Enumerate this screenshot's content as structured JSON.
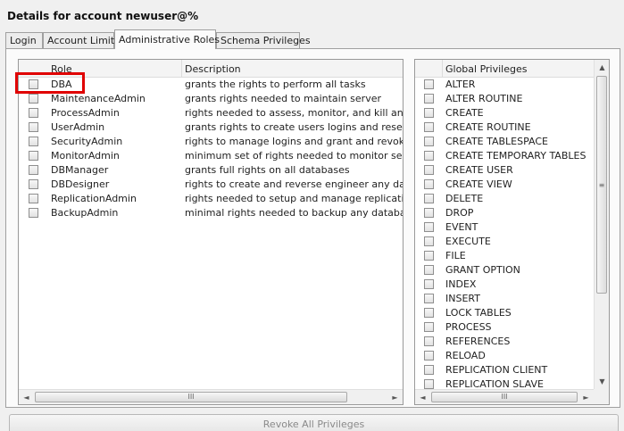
{
  "header": {
    "title": "Details for account newuser@%"
  },
  "tabs": [
    {
      "label": "Login",
      "active": false
    },
    {
      "label": "Account Limits",
      "active": false
    },
    {
      "label": "Administrative Roles",
      "active": true
    },
    {
      "label": "Schema Privileges",
      "active": false
    }
  ],
  "roles": {
    "col_role": "Role",
    "col_description": "Description",
    "items": [
      {
        "role": "DBA",
        "description": "grants the rights to perform all tasks",
        "checked": false
      },
      {
        "role": "MaintenanceAdmin",
        "description": "grants rights needed to maintain server",
        "checked": false
      },
      {
        "role": "ProcessAdmin",
        "description": "rights needed to assess, monitor, and kill any use",
        "checked": false
      },
      {
        "role": "UserAdmin",
        "description": "grants rights to create users logins and reset pas",
        "checked": false
      },
      {
        "role": "SecurityAdmin",
        "description": "rights to manage logins and grant and revoke se",
        "checked": false
      },
      {
        "role": "MonitorAdmin",
        "description": "minimum set of rights needed to monitor server",
        "checked": false
      },
      {
        "role": "DBManager",
        "description": "grants full rights on all databases",
        "checked": false
      },
      {
        "role": "DBDesigner",
        "description": "rights to create and reverse engineer any databa",
        "checked": false
      },
      {
        "role": "ReplicationAdmin",
        "description": "rights needed to setup and manage replication",
        "checked": false
      },
      {
        "role": "BackupAdmin",
        "description": "minimal rights needed to backup any database",
        "checked": false
      }
    ]
  },
  "global_privileges": {
    "header": "Global Privileges",
    "items": [
      "ALTER",
      "ALTER ROUTINE",
      "CREATE",
      "CREATE ROUTINE",
      "CREATE TABLESPACE",
      "CREATE TEMPORARY TABLES",
      "CREATE USER",
      "CREATE VIEW",
      "DELETE",
      "DROP",
      "EVENT",
      "EXECUTE",
      "FILE",
      "GRANT OPTION",
      "INDEX",
      "INSERT",
      "LOCK TABLES",
      "PROCESS",
      "REFERENCES",
      "RELOAD",
      "REPLICATION CLIENT",
      "REPLICATION SLAVE"
    ]
  },
  "scrollbar_thumb_glyph": "III",
  "arrows": {
    "left": "◄",
    "right": "►",
    "up": "▲",
    "down": "▼"
  },
  "revoke_button": {
    "label": "Revoke All Privileges",
    "enabled": false
  },
  "colors": {
    "highlight": "#e00000",
    "disabled_text": "#8a8a8a"
  }
}
